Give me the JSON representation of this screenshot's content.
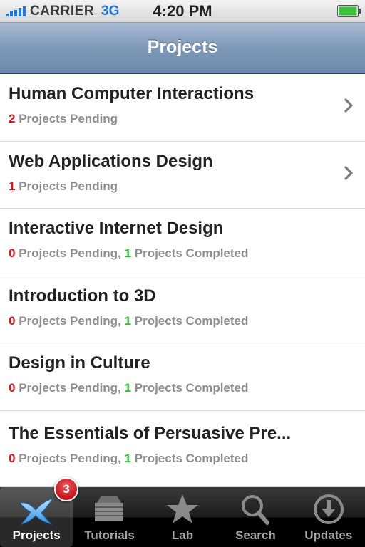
{
  "status_bar": {
    "carrier": "CARRIER",
    "network": "3G",
    "time": "4:20 PM"
  },
  "nav": {
    "title": "Projects"
  },
  "projects": [
    {
      "title": "Human Computer Interactions",
      "pending": "2",
      "pending_text": "Projects Pending",
      "separator": "",
      "completed": "",
      "completed_text": ""
    },
    {
      "title": "Web Applications Design",
      "pending": "1",
      "pending_text": "Projects Pending",
      "separator": "",
      "completed": "",
      "completed_text": ""
    },
    {
      "title": "Interactive Internet Design",
      "pending": "0",
      "pending_text": "Projects Pending",
      "separator": ", ",
      "completed": "1",
      "completed_text": "Projects Completed"
    },
    {
      "title": "Introduction to 3D",
      "pending": "0",
      "pending_text": "Projects Pending",
      "separator": ", ",
      "completed": "1",
      "completed_text": "Projects Completed"
    },
    {
      "title": "Design in Culture",
      "pending": "0",
      "pending_text": "Projects Pending",
      "separator": ", ",
      "completed": "1",
      "completed_text": "Projects Completed"
    },
    {
      "title": "The Essentials of Persuasive Pre...",
      "pending": "0",
      "pending_text": "Projects Pending",
      "separator": ", ",
      "completed": "1",
      "completed_text": "Projects Completed"
    }
  ],
  "tabs": [
    {
      "label": "Projects",
      "icon": "projects-icon",
      "selected": true
    },
    {
      "label": "Tutorials",
      "icon": "tutorials-icon"
    },
    {
      "label": "Lab",
      "icon": "star-icon"
    },
    {
      "label": "Search",
      "icon": "search-icon"
    },
    {
      "label": "Updates",
      "icon": "download-icon"
    }
  ],
  "badge": {
    "count": "3"
  },
  "colors": {
    "pending": "#e0141b",
    "completed": "#2ebd2e",
    "nav": "#7e98b8"
  }
}
